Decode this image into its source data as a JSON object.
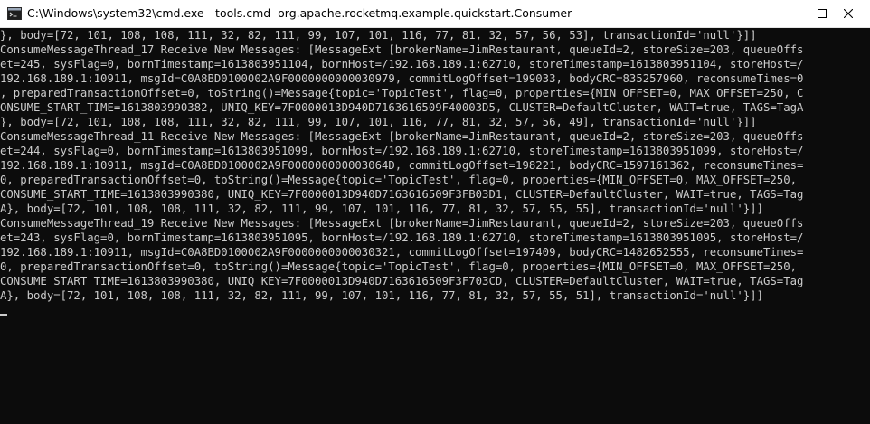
{
  "window": {
    "title": "C:\\Windows\\system32\\cmd.exe - tools.cmd  org.apache.rocketmq.example.quickstart.Consumer",
    "icon": "cmd-icon",
    "controls": [
      "minimize-icon",
      "maximize-icon",
      "close-icon"
    ]
  },
  "console": {
    "lines": [
      "}, body=[72, 101, 108, 108, 111, 32, 82, 111, 99, 107, 101, 116, 77, 81, 32, 57, 56, 53], transactionId='null'}]]",
      "ConsumeMessageThread_17 Receive New Messages: [MessageExt [brokerName=JimRestaurant, queueId=2, storeSize=203, queueOffs",
      "et=245, sysFlag=0, bornTimestamp=1613803951104, bornHost=/192.168.189.1:62710, storeTimestamp=1613803951104, storeHost=/",
      "192.168.189.1:10911, msgId=C0A8BD0100002A9F0000000000030979, commitLogOffset=199033, bodyCRC=835257960, reconsumeTimes=0",
      ", preparedTransactionOffset=0, toString()=Message{topic='TopicTest', flag=0, properties={MIN_OFFSET=0, MAX_OFFSET=250, C",
      "ONSUME_START_TIME=1613803990382, UNIQ_KEY=7F0000013D940D7163616509F40003D5, CLUSTER=DefaultCluster, WAIT=true, TAGS=TagA",
      "}, body=[72, 101, 108, 108, 111, 32, 82, 111, 99, 107, 101, 116, 77, 81, 32, 57, 56, 49], transactionId='null'}]]",
      "ConsumeMessageThread_11 Receive New Messages: [MessageExt [brokerName=JimRestaurant, queueId=2, storeSize=203, queueOffs",
      "et=244, sysFlag=0, bornTimestamp=1613803951099, bornHost=/192.168.189.1:62710, storeTimestamp=1613803951099, storeHost=/",
      "192.168.189.1:10911, msgId=C0A8BD0100002A9F000000000003064D, commitLogOffset=198221, bodyCRC=1597161362, reconsumeTimes=",
      "0, preparedTransactionOffset=0, toString()=Message{topic='TopicTest', flag=0, properties={MIN_OFFSET=0, MAX_OFFSET=250,",
      "CONSUME_START_TIME=1613803990380, UNIQ_KEY=7F0000013D940D7163616509F3FB03D1, CLUSTER=DefaultCluster, WAIT=true, TAGS=Tag",
      "A}, body=[72, 101, 108, 108, 111, 32, 82, 111, 99, 107, 101, 116, 77, 81, 32, 57, 55, 55], transactionId='null'}]]",
      "ConsumeMessageThread_19 Receive New Messages: [MessageExt [brokerName=JimRestaurant, queueId=2, storeSize=203, queueOffs",
      "et=243, sysFlag=0, bornTimestamp=1613803951095, bornHost=/192.168.189.1:62710, storeTimestamp=1613803951095, storeHost=/",
      "192.168.189.1:10911, msgId=C0A8BD0100002A9F0000000000030321, commitLogOffset=197409, bodyCRC=1482652555, reconsumeTimes=",
      "0, preparedTransactionOffset=0, toString()=Message{topic='TopicTest', flag=0, properties={MIN_OFFSET=0, MAX_OFFSET=250,",
      "CONSUME_START_TIME=1613803990380, UNIQ_KEY=7F0000013D940D7163616509F3F703CD, CLUSTER=DefaultCluster, WAIT=true, TAGS=Tag",
      "A}, body=[72, 101, 108, 108, 111, 32, 82, 111, 99, 107, 101, 116, 77, 81, 32, 57, 55, 51], transactionId='null'}]]"
    ],
    "foreground": "#cccccc",
    "background": "#0c0c0c"
  }
}
